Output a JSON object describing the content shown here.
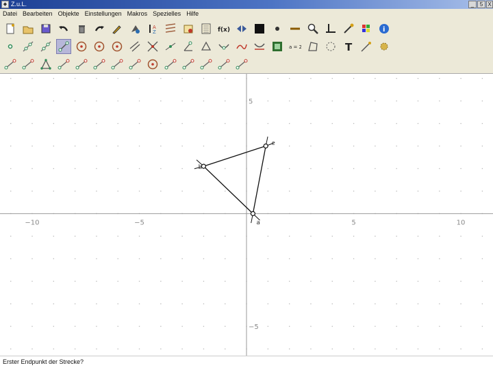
{
  "window": {
    "title": "Z.u.L.",
    "app_icon_glyph": "◆",
    "min_label": "_",
    "max_label": "5",
    "close_label": "X"
  },
  "menu": {
    "items": [
      "Datei",
      "Bearbeiten",
      "Objekte",
      "Einstellungen",
      "Makros",
      "Spezielles",
      "Hilfe"
    ]
  },
  "toolbar": {
    "function_label": "f(x)",
    "text_tool_label": "T",
    "equation_label": "a = 2",
    "rows": [
      [
        "new-file-icon",
        "open-file-icon",
        "save-file-icon",
        "undo-icon",
        "delete-icon",
        "redo-icon",
        "edit-icon",
        "color-icon",
        "sort-icon",
        "grid-icon",
        "load-icon",
        "notes-icon",
        "function-icon",
        "arrows-icon",
        "fill-icon",
        "point-style-icon",
        "line-style-icon",
        "zoom-icon",
        "axes-icon",
        "magic-icon",
        "palette-icon",
        "info-icon"
      ],
      [
        "point-icon",
        "line-icon",
        "ray-icon",
        "segment-icon",
        "circle-icon",
        "circle3-icon",
        "compass-icon",
        "parallel-icon",
        "intersection-icon",
        "midpoint-icon",
        "angle-icon",
        "polygon-icon",
        "move-icon",
        "track-icon",
        "animate-icon",
        "film-icon",
        "expression-icon",
        "quadrilateral-icon",
        "locus-icon",
        "text-icon",
        "trace-icon",
        "settings-icon"
      ],
      [
        "tool-a-icon",
        "tool-b-icon",
        "triangle-icon",
        "tool-d-icon",
        "tool-e-icon",
        "tool-f-icon",
        "tool-g-icon",
        "tool-h-icon",
        "circle-construct-icon",
        "tool-j-icon",
        "tool-k-icon",
        "tool-l-icon",
        "tool-m-icon",
        "tool-n-icon"
      ]
    ]
  },
  "canvas": {
    "x_range": [
      -11.5,
      11.5
    ],
    "y_range": [
      -6.3,
      6.2
    ],
    "grid": true,
    "axis_color": "#999999",
    "grid_dot_color": "#b8b8b8",
    "object_color": "#111111",
    "tick_labels_x": [
      "−10",
      "−5",
      "5",
      "10"
    ],
    "tick_values_x": [
      -10,
      -5,
      5,
      10
    ],
    "tick_labels_y": [
      "5",
      "−5"
    ],
    "tick_values_y": [
      5,
      -5
    ],
    "points": [
      {
        "name": "a",
        "x": 0.3,
        "y": 0
      },
      {
        "name": "b",
        "x": -2.0,
        "y": 2.1
      },
      {
        "name": "c",
        "x": 0.9,
        "y": 3.0
      }
    ],
    "segments": [
      [
        "a",
        "b"
      ],
      [
        "b",
        "c"
      ],
      [
        "c",
        "a"
      ]
    ]
  },
  "status": {
    "text": "Erster Endpunkt der Strecke?"
  }
}
